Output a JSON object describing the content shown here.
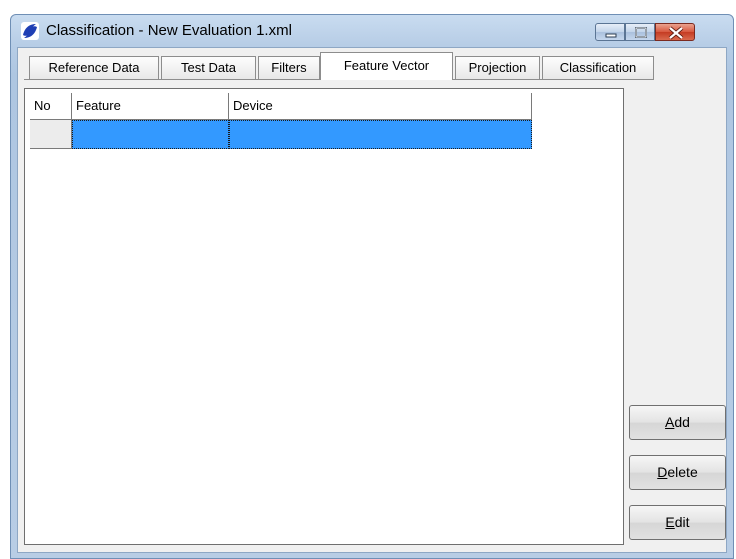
{
  "window": {
    "title": "Classification - New Evaluation 1.xml",
    "controls": {
      "minimize": "minimize",
      "maximize": "maximize",
      "close": "close"
    },
    "colors": {
      "accent": "#3399ff",
      "close": "#c43b22"
    }
  },
  "tabs": [
    {
      "label": "Reference Data"
    },
    {
      "label": "Test Data"
    },
    {
      "label": "Filters"
    },
    {
      "label": "Feature Vector",
      "active": true
    },
    {
      "label": "Projection"
    },
    {
      "label": "Classification"
    }
  ],
  "grid": {
    "columns": [
      "No",
      "Feature",
      "Device"
    ],
    "rows": [
      {
        "no": "",
        "feature": "",
        "device": ""
      }
    ],
    "selected_row": 1
  },
  "buttons": {
    "add": {
      "mnemonic": "A",
      "rest": "dd"
    },
    "delete": {
      "mnemonic": "D",
      "rest": "elete"
    },
    "edit": {
      "mnemonic": "E",
      "rest": "dit"
    }
  }
}
